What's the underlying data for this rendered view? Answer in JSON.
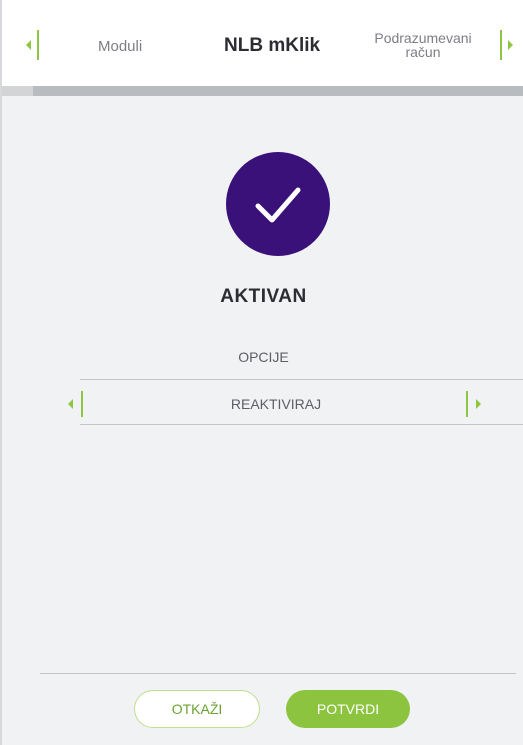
{
  "header": {
    "prev_label": "Moduli",
    "title": "NLB mKlik",
    "next_label_line1": "Podrazumevani",
    "next_label_line2": "račun",
    "progress_fraction": 0.06
  },
  "status": {
    "icon": "checkmark-icon",
    "label": "AKTIVAN"
  },
  "options": {
    "title": "OPCIJE",
    "selected_value": "REAKTIVIRAJ"
  },
  "footer": {
    "cancel_label": "OTKAŽI",
    "confirm_label": "POTVRDI"
  },
  "colors": {
    "accent_green": "#8dc43f",
    "status_purple": "#3a1079",
    "background": "#f1f2f3"
  }
}
